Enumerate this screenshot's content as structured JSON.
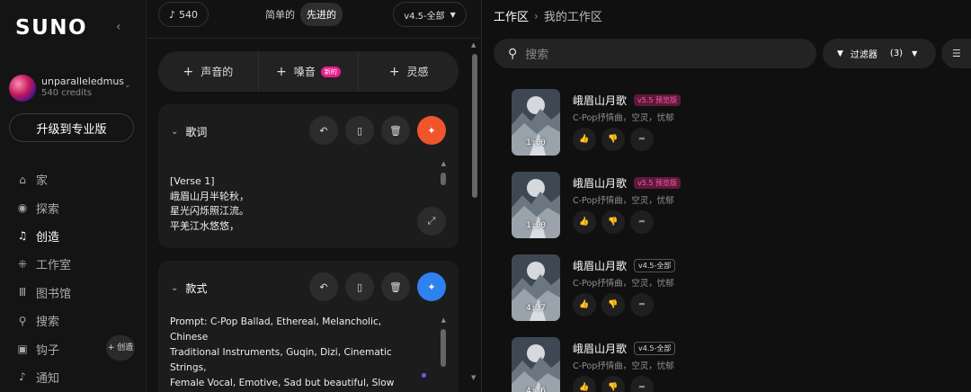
{
  "sidebar": {
    "logo": "SUNO",
    "user": {
      "name": "unparalleledmusi",
      "credits": "540 credits"
    },
    "upgrade_label": "升级到专业版",
    "nav": [
      {
        "label": "家",
        "icon": "home-icon"
      },
      {
        "label": "探索",
        "icon": "compass-icon"
      },
      {
        "label": "创造",
        "icon": "music-note-icon",
        "active": true
      },
      {
        "label": "工作室",
        "icon": "studio-icon"
      },
      {
        "label": "图书馆",
        "icon": "library-icon"
      },
      {
        "label": "搜索",
        "icon": "search-icon"
      },
      {
        "label": "钩子",
        "icon": "hooks-icon"
      },
      {
        "label": "通知",
        "icon": "bell-icon"
      }
    ],
    "create_mini_label": "+ 创造"
  },
  "create_panel": {
    "credit_count": "540",
    "mode_simple": "简单的",
    "mode_advanced": "先进的",
    "version": "v4.5-全部",
    "add_buttons": [
      {
        "label": "声音的"
      },
      {
        "label": "嗓音",
        "badge": "新的"
      },
      {
        "label": "灵感"
      }
    ],
    "lyrics": {
      "title": "歌词",
      "lines": [
        "[Verse 1]",
        "峨眉山月半轮秋，",
        "星光闪烁照江流。",
        "平羌江水悠悠，"
      ]
    },
    "style": {
      "title": "款式",
      "lines": [
        "Prompt: C-Pop Ballad, Ethereal, Melancholic, Chinese",
        "Traditional Instruments, Guqin, Dizi, Cinematic Strings,",
        "Female Vocal, Emotive, Sad but beautiful, Slow tempo."
      ]
    }
  },
  "workspace": {
    "breadcrumb_root": "工作区",
    "breadcrumb_current": "我的工作区",
    "search_placeholder": "搜索",
    "filter_label": "过滤器",
    "filter_count": "(3)",
    "songs": [
      {
        "title": "峨眉山月歌",
        "version": "v5.5 预览版",
        "version_style": "pink",
        "style": "C-Pop抒情曲，空灵，忧郁",
        "duration": "1:00"
      },
      {
        "title": "峨眉山月歌",
        "version": "v5.5 预览版",
        "version_style": "pink",
        "style": "C-Pop抒情曲，空灵，忧郁",
        "duration": "1:00"
      },
      {
        "title": "峨眉山月歌",
        "version": "v4.5-全部",
        "version_style": "gray",
        "style": "C-Pop抒情曲，空灵，忧郁",
        "duration": "4:37"
      },
      {
        "title": "峨眉山月歌",
        "version": "v4.5-全部",
        "version_style": "gray",
        "style": "C-Pop抒情曲，空灵，忧郁",
        "duration": "4:16"
      }
    ]
  }
}
